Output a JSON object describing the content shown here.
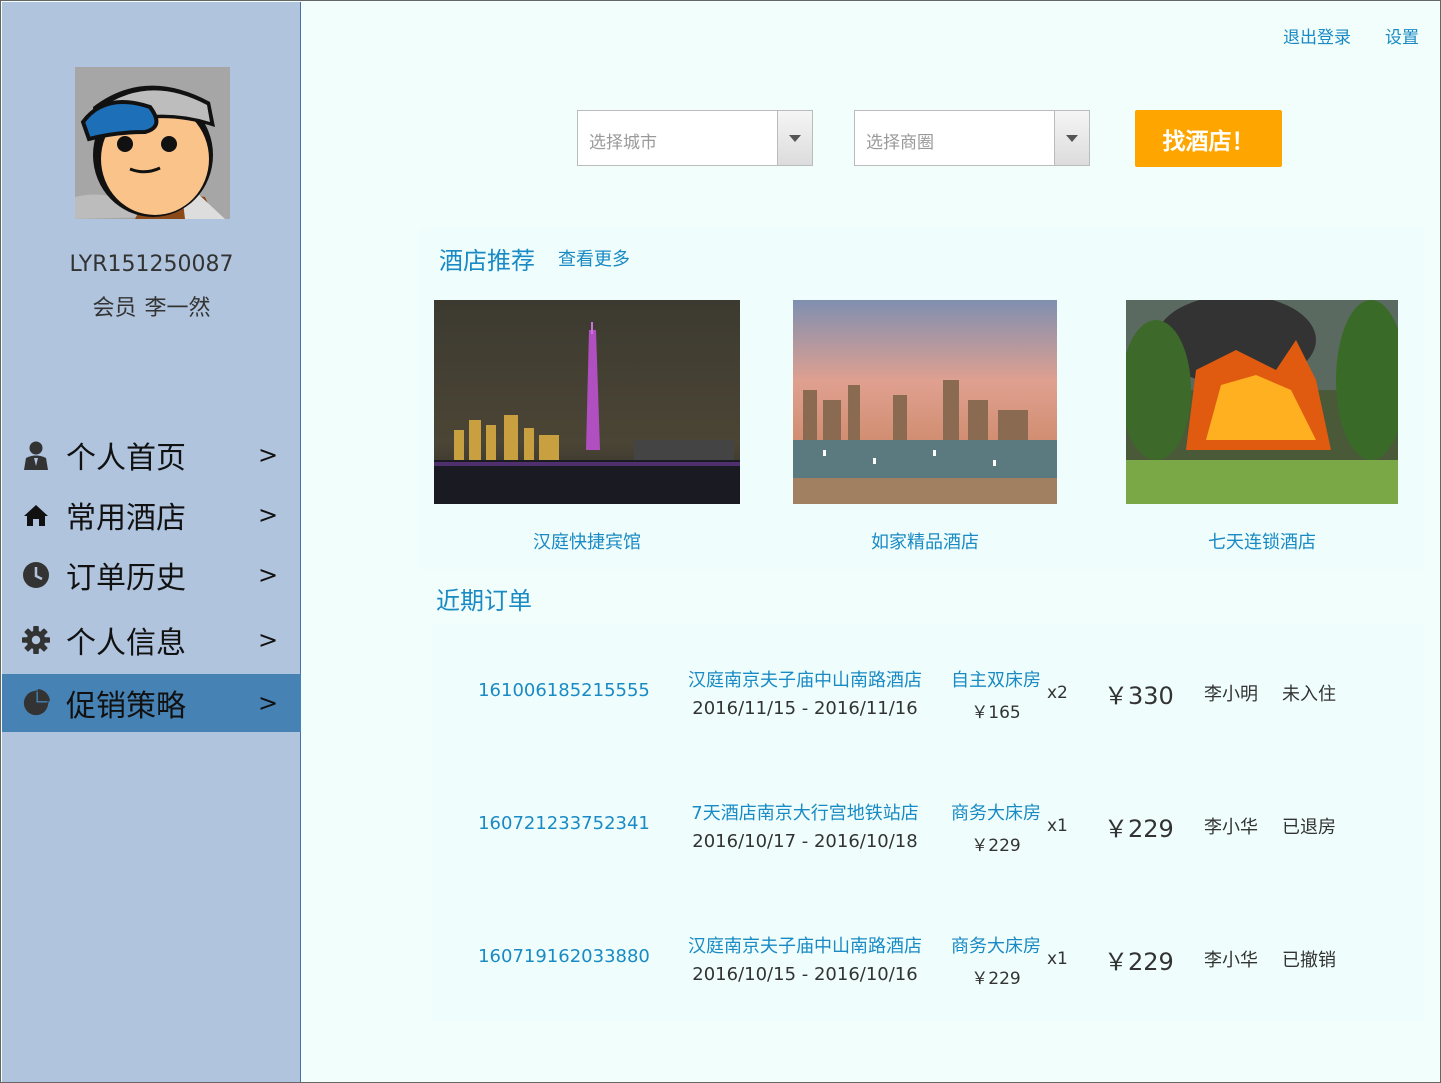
{
  "top_links": {
    "logout": "退出登录",
    "settings": "设置"
  },
  "user": {
    "id": "LYR151250087",
    "role": "会员",
    "name": "李一然"
  },
  "nav": [
    {
      "label": "个人首页",
      "arrow": ">",
      "icon": "user-icon"
    },
    {
      "label": "常用酒店",
      "arrow": ">",
      "icon": "home-icon"
    },
    {
      "label": "订单历史",
      "arrow": ">",
      "icon": "clock-icon"
    },
    {
      "label": "个人信息",
      "arrow": ">",
      "icon": "gear-icon"
    },
    {
      "label": "促销策略",
      "arrow": ">",
      "icon": "pie-chart-icon",
      "active": true
    }
  ],
  "search": {
    "city_placeholder": "选择城市",
    "area_placeholder": "选择商圈",
    "button": "找酒店！"
  },
  "recommend": {
    "title": "酒店推荐",
    "more": "查看更多",
    "hotels": [
      {
        "name": "汉庭快捷宾馆"
      },
      {
        "name": "如家精品酒店"
      },
      {
        "name": "七天连锁酒店"
      }
    ]
  },
  "orders": {
    "title": "近期订单",
    "items": [
      {
        "id": "161006185215555",
        "hotel": "汉庭南京夫子庙中山南路酒店",
        "dates": "2016/11/15 - 2016/11/16",
        "room": "自主双床房",
        "unit_price": "￥165",
        "qty": "x2",
        "total": "￥330",
        "guest": "李小明",
        "status": "未入住"
      },
      {
        "id": "160721233752341",
        "hotel": "7天酒店南京大行宫地铁站店",
        "dates": "2016/10/17 - 2016/10/18",
        "room": "商务大床房",
        "unit_price": "￥229",
        "qty": "x1",
        "total": "￥229",
        "guest": "李小华",
        "status": "已退房"
      },
      {
        "id": "160719162033880",
        "hotel": "汉庭南京夫子庙中山南路酒店",
        "dates": "2016/10/15 - 2016/10/16",
        "room": "商务大床房",
        "unit_price": "￥229",
        "qty": "x1",
        "total": "￥229",
        "guest": "李小华",
        "status": "已撤销"
      }
    ]
  },
  "colors": {
    "sidebar": "#b0c4de",
    "active_nav": "#4682b4",
    "link": "#1a8ac4",
    "accent": "#ffa500"
  }
}
